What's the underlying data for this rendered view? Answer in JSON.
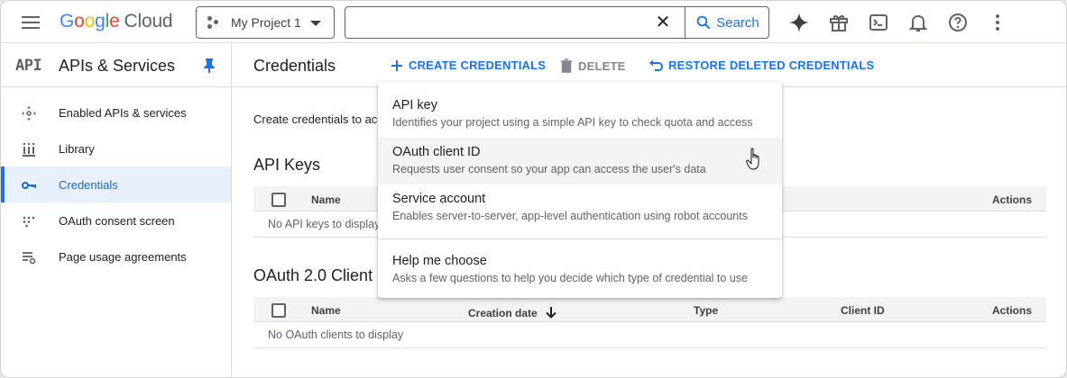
{
  "topbar": {
    "logo": {
      "g1": "G",
      "o1": "o",
      "o2": "o",
      "g2": "g",
      "l": "l",
      "e": "e",
      "cloud": "Cloud"
    },
    "project": "My Project 1",
    "search": {
      "value": "",
      "placeholder": "",
      "button": "Search"
    },
    "icons": [
      "menu-icon",
      "gemini-icon",
      "gift-icon",
      "terminal-icon",
      "bell-icon",
      "help-icon",
      "more-vert-icon"
    ]
  },
  "sidebar": {
    "badge": "API",
    "title": "APIs & Services",
    "items": [
      {
        "label": "Enabled APIs & services",
        "icon": "hub-icon"
      },
      {
        "label": "Library",
        "icon": "library-icon"
      },
      {
        "label": "Credentials",
        "icon": "key-icon",
        "active": true
      },
      {
        "label": "OAuth consent screen",
        "icon": "consent-icon"
      },
      {
        "label": "Page usage agreements",
        "icon": "settings-list-icon"
      }
    ]
  },
  "main": {
    "title": "Credentials",
    "actions": {
      "create": "CREATE CREDENTIALS",
      "delete": "DELETE",
      "restore": "RESTORE DELETED CREDENTIALS"
    },
    "intro": "Create credentials to access your enabled APIs.",
    "api_keys": {
      "title": "API Keys",
      "columns": [
        "Name",
        "Actions"
      ],
      "empty": "No API keys to display"
    },
    "oauth": {
      "title": "OAuth 2.0 Client IDs",
      "columns": [
        "Name",
        "Creation date",
        "Type",
        "Client ID",
        "Actions"
      ],
      "empty": "No OAuth clients to display"
    }
  },
  "menu": {
    "items": [
      {
        "title": "API key",
        "desc": "Identifies your project using a simple API key to check quota and access"
      },
      {
        "title": "OAuth client ID",
        "desc": "Requests user consent so your app can access the user's data",
        "hover": true
      },
      {
        "title": "Service account",
        "desc": "Enables server-to-server, app-level authentication using robot accounts"
      },
      {
        "title": "Help me choose",
        "desc": "Asks a few questions to help you decide which type of credential to use"
      }
    ]
  },
  "colors": {
    "accent": "#1a73e8",
    "active_bg": "#e8f0fe",
    "hover_bg": "#f1f3f4"
  }
}
